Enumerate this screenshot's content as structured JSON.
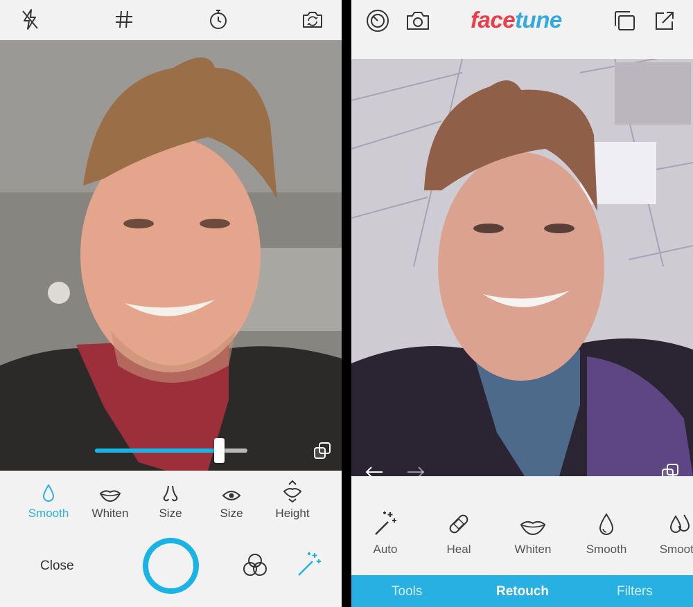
{
  "camera": {
    "toolbar": {
      "flash_icon": "flash-off-icon",
      "grid_icon": "grid-icon",
      "timer_icon": "timer-icon",
      "flip_icon": "flip-camera-icon"
    },
    "slider": {
      "value": 0.82
    },
    "tools": [
      {
        "label": "Smooth",
        "icon": "droplet-icon",
        "active": true
      },
      {
        "label": "Whiten",
        "icon": "lips-icon",
        "active": false
      },
      {
        "label": "Size",
        "icon": "nose-icon",
        "active": false
      },
      {
        "label": "Size",
        "icon": "eye-icon",
        "active": false
      },
      {
        "label": "Height",
        "icon": "face-height-icon",
        "active": false
      }
    ],
    "close_label": "Close",
    "accent_color": "#1ab3e6"
  },
  "editor": {
    "logo_part1": "face",
    "logo_part2": "tune",
    "logo_colors": {
      "face": "#ef3d47",
      "tune": "#33a8e2"
    },
    "tools": [
      {
        "label": "Auto",
        "icon": "magic-wand-icon"
      },
      {
        "label": "Heal",
        "icon": "bandage-icon"
      },
      {
        "label": "Whiten",
        "icon": "lips-icon"
      },
      {
        "label": "Smooth",
        "icon": "droplet-icon"
      },
      {
        "label": "Smooth",
        "icon": "double-droplet-icon"
      }
    ],
    "tabs": [
      {
        "label": "Tools",
        "active": false
      },
      {
        "label": "Retouch",
        "active": true
      },
      {
        "label": "Filters",
        "active": false
      }
    ],
    "tab_bar_color": "#29b0e2"
  }
}
